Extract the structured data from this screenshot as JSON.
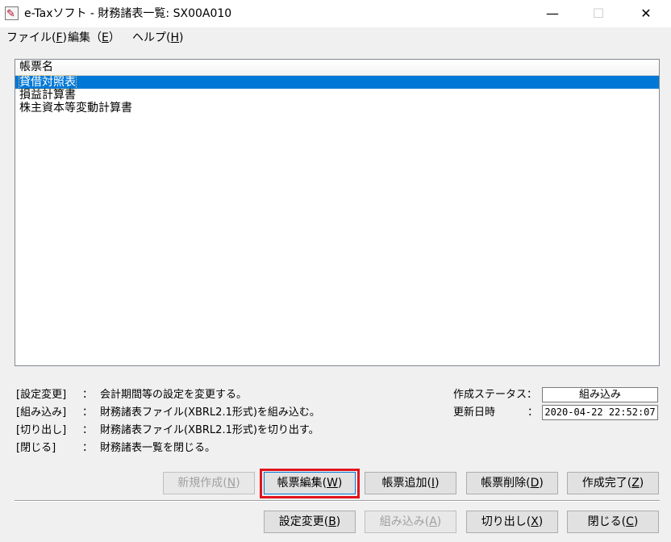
{
  "window": {
    "title": "e-Taxソフト - 財務諸表一覧: SX00A010",
    "icon": "etax-app-icon",
    "minimize": "—",
    "maximize": "☐",
    "close": "✕"
  },
  "menu": [
    {
      "label": "ファイル(",
      "key": "F",
      "suffix": ")"
    },
    {
      "label": "編集（",
      "key": "E",
      "suffix": "）"
    },
    {
      "label": "ヘルプ(",
      "key": "H",
      "suffix": ")"
    }
  ],
  "list": {
    "header": "帳票名",
    "rows": [
      "貸借対照表",
      "損益計算書",
      "株主資本等変動計算書"
    ],
    "selected_index": 0
  },
  "help_lines": [
    {
      "key": "[設定変更]",
      "colon": "：",
      "desc": "会計期間等の設定を変更する。"
    },
    {
      "key": "[組み込み]",
      "colon": "：",
      "desc": "財務諸表ファイル(XBRL2.1形式)を組み込む。"
    },
    {
      "key": "[切り出し]",
      "colon": "：",
      "desc": "財務諸表ファイル(XBRL2.1形式)を切り出す。"
    },
    {
      "key": "[閉じる]",
      "colon": "：",
      "desc": "財務諸表一覧を閉じる。"
    }
  ],
  "status": {
    "label": "作成ステータス：",
    "value": "組み込み",
    "updated_label": "更新日時",
    "updated_colon": "：",
    "updated_value": "2020-04-22 22:52:07"
  },
  "buttons_row1": [
    {
      "label": "新規作成(",
      "key": "N",
      "suffix": ")",
      "enabled": false
    },
    {
      "label": "帳票編集(",
      "key": "W",
      "suffix": ")",
      "enabled": true
    },
    {
      "label": "帳票追加(",
      "key": "I",
      "suffix": ")",
      "enabled": true
    },
    {
      "label": "帳票削除(",
      "key": "D",
      "suffix": ")",
      "enabled": true
    },
    {
      "label": "作成完了(",
      "key": "Z",
      "suffix": ")",
      "enabled": true
    }
  ],
  "buttons_row2": [
    {
      "label": "設定変更(",
      "key": "B",
      "suffix": ")",
      "enabled": true
    },
    {
      "label": "組み込み(",
      "key": "A",
      "suffix": ")",
      "enabled": false
    },
    {
      "label": "切り出し(",
      "key": "X",
      "suffix": ")",
      "enabled": true
    },
    {
      "label": "閉じる(",
      "key": "C",
      "suffix": ")",
      "enabled": true
    }
  ],
  "colors": {
    "selection": "#0078d7",
    "highlight_box": "#e1141e"
  }
}
